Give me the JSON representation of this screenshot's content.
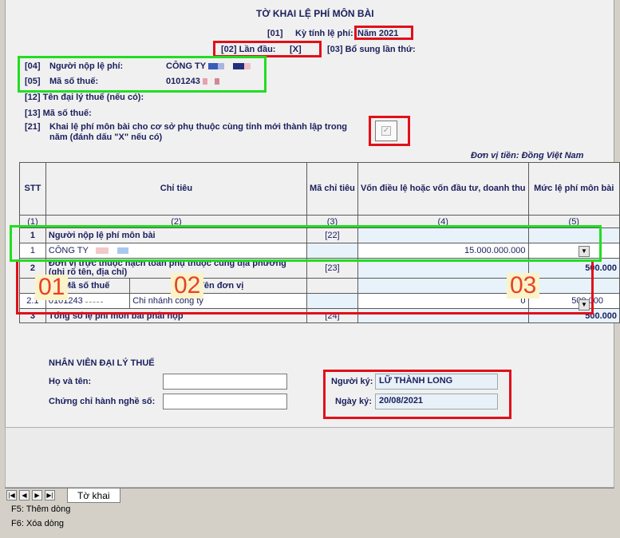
{
  "form": {
    "title": "TỜ KHAI LỆ PHÍ MÔN BÀI",
    "period_code": "[01]",
    "period_label": "Kỳ tính lệ phí:",
    "period_value": "Năm 2021",
    "first_code": "[02] Lần đầu:",
    "first_value": "[X]",
    "supplement_label": "[03] Bổ sung lần thứ:",
    "payer_code": "[04]",
    "payer_label": "Người nộp lệ phí:",
    "payer_value": "CÔNG TY",
    "tax_code_code": "[05]",
    "tax_code_label": "Mã số thuế:",
    "tax_code_value": "0101243",
    "agent_name_label": "[12]  Tên đại lý thuế (nếu có):",
    "agent_tax_label": "[13]  Mã số thuế:",
    "dep_code": "[21]",
    "dep_label_1": "Khai lệ phí môn bài cho cơ sở phụ thuộc cùng tỉnh mới thành lập trong",
    "dep_label_2": "năm (đánh dấu \"X\" nếu có)",
    "currency_note": "Đơn vị tiền: Đồng Việt Nam"
  },
  "table": {
    "headers": {
      "stt": "STT",
      "chi_tieu": "Chỉ tiêu",
      "ma_chi_tieu": "Mã chỉ tiêu",
      "von": "Vốn điều lệ hoặc vốn đầu tư, doanh thu",
      "muc_le_phi": "Mức lệ phí môn bài"
    },
    "index_row": [
      "(1)",
      "(2)",
      "(3)",
      "(4)",
      "(5)"
    ],
    "row1": {
      "stt": "1",
      "label": "Người nộp lệ phí môn bài",
      "code": "[22]"
    },
    "row1_1": {
      "stt": "1",
      "name": "CÔNG TY",
      "capital": "15.000.000.000",
      "fee": ""
    },
    "row2": {
      "stt": "2",
      "label": "Đơn vị trực thuộc hạch toán phụ thuộc cùng địa phương (ghi rõ tên, địa chỉ)",
      "code": "[23]",
      "fee": "500.000"
    },
    "row2_sub": {
      "ma_so_thue": "Mã số thuế",
      "ten_don_vi": "Tên đơn vị"
    },
    "row2_1": {
      "stt": "2.1",
      "tax_code": "0101243",
      "name": "Chi nhánh công ty",
      "capital": "0",
      "fee": "500.000"
    },
    "row3": {
      "stt": "3",
      "label": "Tổng số lệ phí môn bài phải nộp",
      "code": "[24]",
      "fee": "500.000"
    }
  },
  "annotations": [
    "01",
    "02",
    "03"
  ],
  "agent_staff": {
    "heading": "NHÂN VIÊN ĐẠI LÝ THUẾ",
    "name_label": "Họ và tên:",
    "name_value": "",
    "cert_label": "Chứng chỉ hành nghề số:",
    "cert_value": ""
  },
  "signer": {
    "signer_label": "Người ký:",
    "signer_value": "LỮ THÀNH LONG",
    "date_label": "Ngày ký:",
    "date_value": "20/08/2021"
  },
  "tabs": {
    "active": "Tờ khai"
  },
  "help": {
    "f5": "F5: Thêm dòng",
    "f6": "F6: Xóa dòng"
  },
  "colors": {
    "red_box": "#e0101a",
    "green_box": "#22dd22",
    "annotation": "#e8402a",
    "annotation_bg": "#fbf3c8",
    "text_navy": "#1a1f5c"
  }
}
